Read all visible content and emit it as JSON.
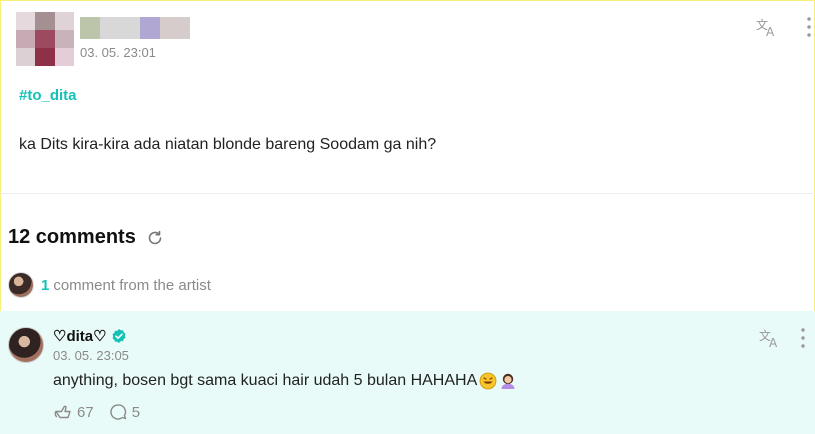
{
  "post": {
    "date": "03. 05. 23:01",
    "hashtag": "#to_dita",
    "body": "ka Dits kira-kira ada niatan blonde bareng Soodam ga nih?"
  },
  "comments_section": {
    "title": "12 comments",
    "artist_count": "1",
    "artist_label": "comment from the artist"
  },
  "comment": {
    "name": "♡dita♡",
    "date": "03. 05. 23:05",
    "body": "anything, bosen bgt sama kuaci hair udah 5 bulan HAHAHA",
    "likes": "67",
    "replies": "5"
  },
  "colors": {
    "accent": "#14c1b7",
    "comment_bg": "#e9fbf8",
    "muted_text": "#8a8a8a"
  },
  "icons": [
    "translate-icon",
    "more-vertical-icon",
    "refresh-icon",
    "verified-icon",
    "like-icon",
    "reply-icon",
    "rofl-emoji-icon",
    "person-emoji-icon"
  ]
}
